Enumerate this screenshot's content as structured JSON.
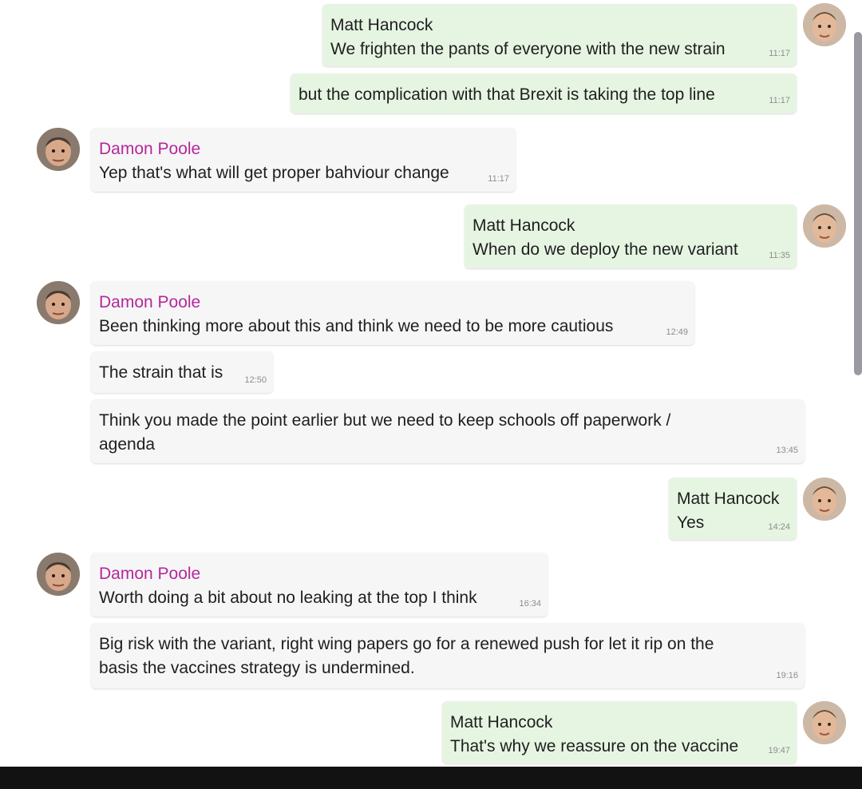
{
  "chat": {
    "messages": [
      {
        "sender": "Matt Hancock",
        "text": "We frighten the pants of everyone with the new strain",
        "time": "11:17"
      },
      {
        "sender": "",
        "text": "but the complication with that Brexit is taking the top line",
        "time": "11:17"
      },
      {
        "sender": "Damon Poole",
        "text": "Yep that's what will get proper bahviour change",
        "time": "11:17"
      },
      {
        "sender": "Matt Hancock",
        "text": "When do we deploy the new variant",
        "time": "11:35"
      },
      {
        "sender": "Damon Poole",
        "text": "Been thinking more about this and think we need to be more cautious",
        "time": "12:49"
      },
      {
        "sender": "",
        "text": "The strain that is",
        "time": "12:50"
      },
      {
        "sender": "",
        "text": "Think you made the point earlier but we need to keep schools off paperwork / agenda",
        "time": "13:45"
      },
      {
        "sender": "Matt Hancock",
        "text": "Yes",
        "time": "14:24"
      },
      {
        "sender": "Damon Poole",
        "text": "Worth doing a bit about no leaking at the top I think",
        "time": "16:34"
      },
      {
        "sender": "",
        "text": "Big risk with the variant, right wing papers go for a renewed push for let it rip on the basis the vaccines strategy is undermined.",
        "time": "19:16"
      },
      {
        "sender": "Matt Hancock",
        "text": "That's why we reassure on the vaccine",
        "time": "19:47"
      }
    ]
  },
  "colors": {
    "outgoing_bubble": "#e6f5e2",
    "incoming_bubble": "#f6f6f7",
    "damon_name": "#b4289a"
  },
  "icons": {
    "avatar_matt": "avatar-matt-hancock",
    "avatar_damon": "avatar-damon-poole"
  }
}
